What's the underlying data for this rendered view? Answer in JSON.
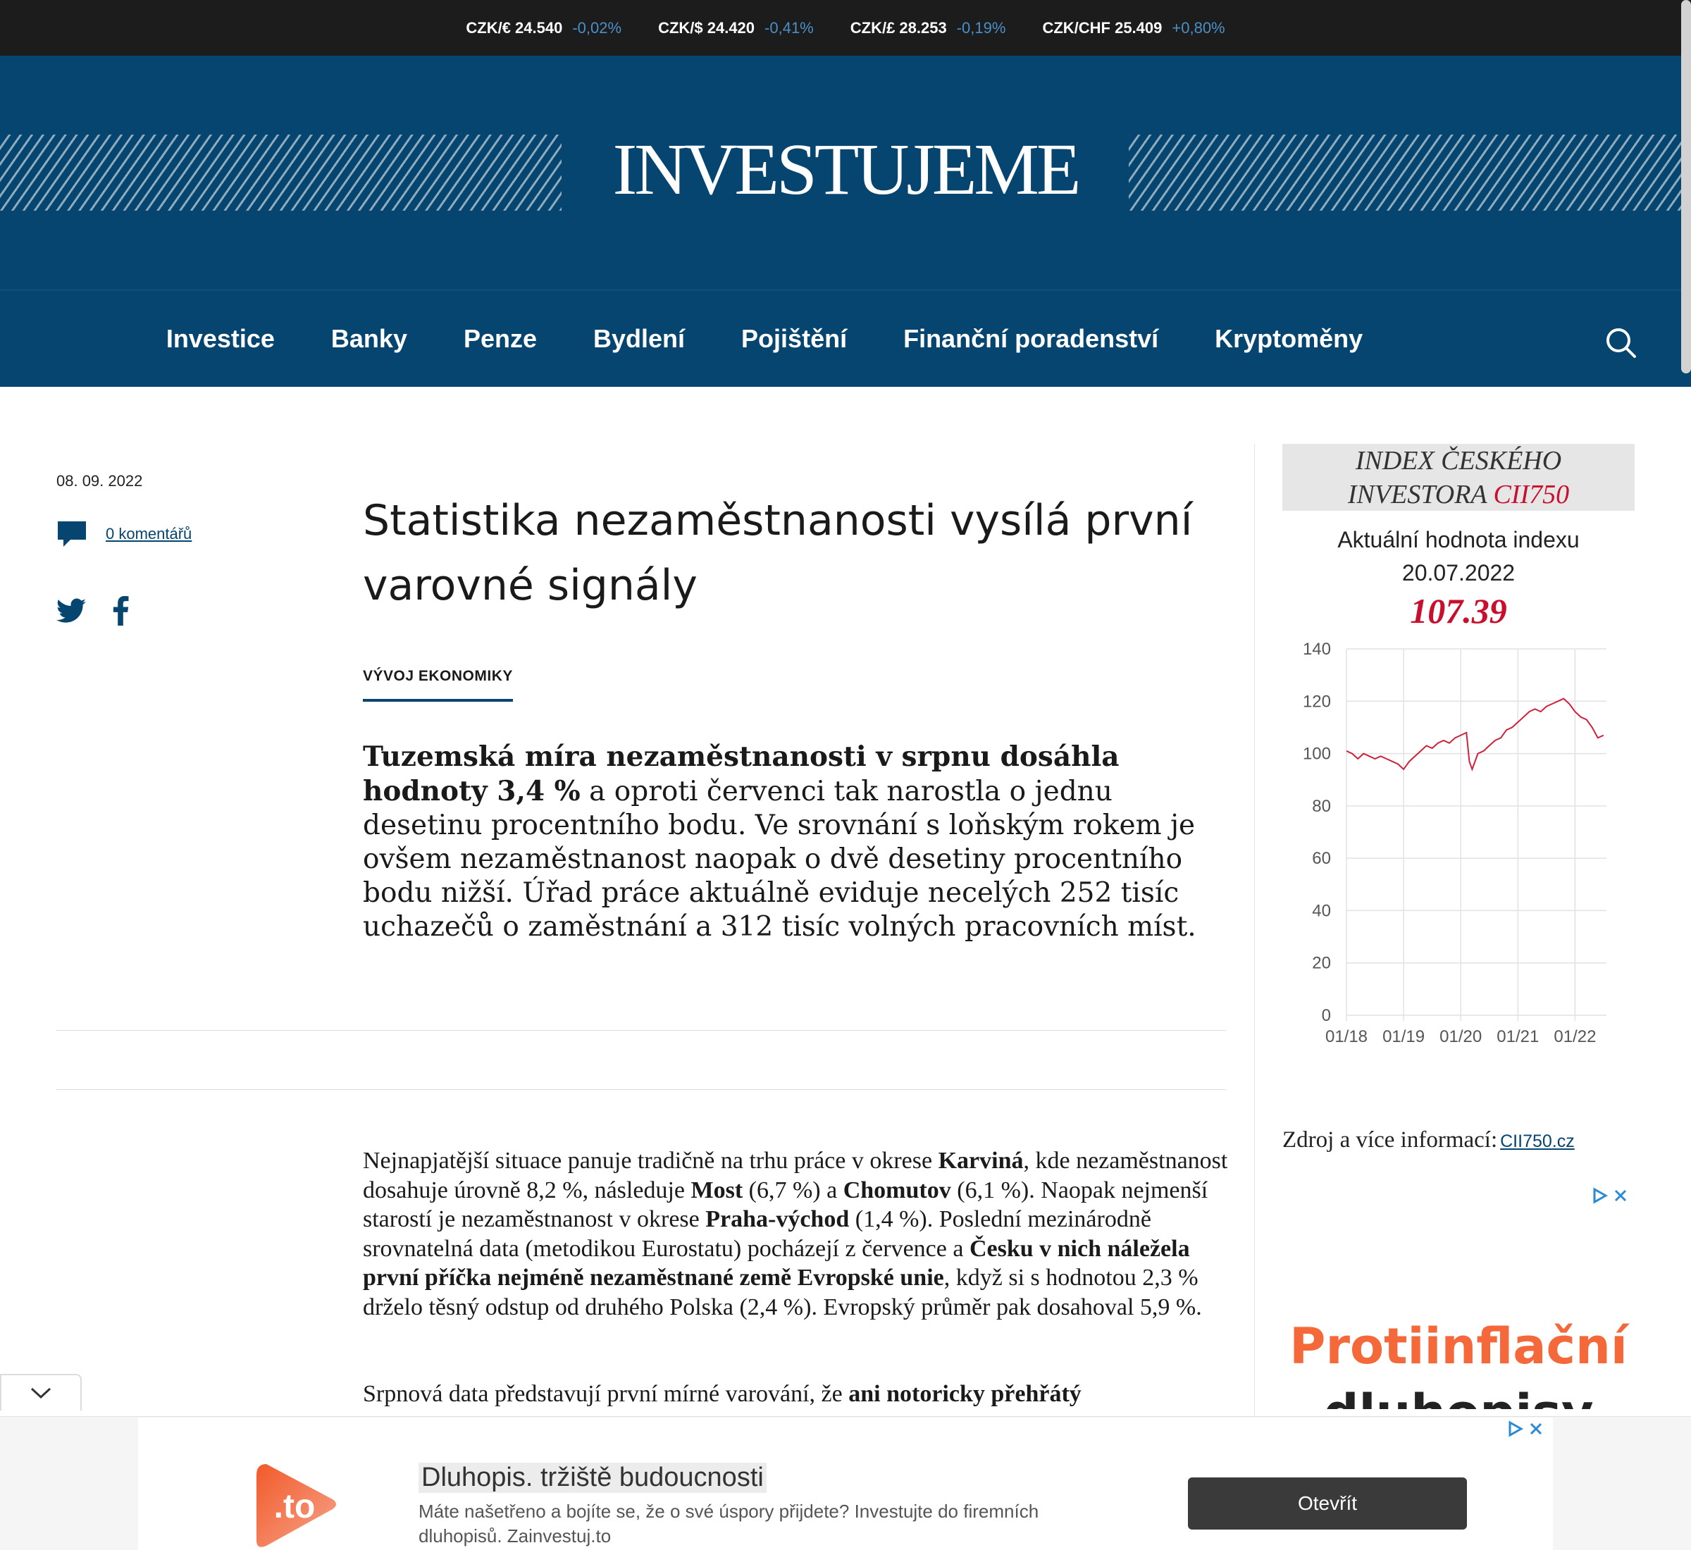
{
  "ticker": [
    {
      "pair": "CZK/€ 24.540",
      "change": "-0,02%"
    },
    {
      "pair": "CZK/$ 24.420",
      "change": "-0,41%"
    },
    {
      "pair": "CZK/£ 28.253",
      "change": "-0,19%"
    },
    {
      "pair": "CZK/CHF 25.409",
      "change": "+0,80%"
    }
  ],
  "site": {
    "logo": "INVESTUJEME"
  },
  "nav": {
    "items": [
      "Investice",
      "Banky",
      "Penze",
      "Bydlení",
      "Pojištění",
      "Finanční poradenství",
      "Kryptoměny"
    ],
    "search_icon": "search-icon"
  },
  "article": {
    "date": "08. 09. 2022",
    "comments": "0 komentářů",
    "title": "Statistika nezaměstnanosti vysílá první varovné signály",
    "category": "VÝVOJ EKONOMIKY",
    "lead_bold": "Tuzemská míra nezaměstnanosti v srpnu dosáhla hodnoty 3,4 %",
    "lead_rest": " a oproti červenci tak narostla o jednu desetinu procentního bodu. Ve srovnání s loňským rokem je ovšem nezaměstnanost naopak o dvě desetiny procentního bodu nižší. Úřad práce aktuálně eviduje necelých 252 tisíc uchazečů o zaměstnání a 312 tisíc volných pracovních míst.",
    "p1": [
      {
        "t": "Nejnapjatější situace panuje tradičně na trhu práce v okrese ",
        "b": false
      },
      {
        "t": "Karviná",
        "b": true
      },
      {
        "t": ", kde nezaměstnanost dosahuje úrovně 8,2 %, následuje ",
        "b": false
      },
      {
        "t": "Most",
        "b": true
      },
      {
        "t": " (6,7 %) a ",
        "b": false
      },
      {
        "t": "Chomutov",
        "b": true
      },
      {
        "t": " (6,1 %). Naopak nejmenší starostí je nezaměstnanost v okrese ",
        "b": false
      },
      {
        "t": "Praha-východ",
        "b": true
      },
      {
        "t": " (1,4 %). Poslední mezinárodně srovnatelná data (metodikou Eurostatu) pocházejí z července a ",
        "b": false
      },
      {
        "t": "Česku v nich náležela první příčka nejméně nezaměstnané země Evropské unie",
        "b": true
      },
      {
        "t": ", když si s hodnotou 2,3 % drželo těsný odstup od druhého Polska (2,4 %). Evropský průměr pak dosahoval 5,9 %.",
        "b": false
      }
    ],
    "p2_plain": "Srpnová data představují první mírné varování, že ",
    "p2_bold": "ani notoricky přehřátý"
  },
  "sidebar": {
    "index_title_1": "INDEX ČESKÉHO",
    "index_title_2": "INVESTORA ",
    "index_title_code": "CII750",
    "current_label": "Aktuální hodnota indexu",
    "current_date": "20.07.2022",
    "current_value": "107.39",
    "source_label": "Zdroj a více informací:",
    "source_link": "CII750.cz",
    "ad_text_1": "Protiinflační",
    "ad_text_2": "dluhopisy"
  },
  "chart_data": {
    "type": "line",
    "x_ticks": [
      "01/18",
      "01/19",
      "01/20",
      "01/21",
      "01/22"
    ],
    "y_ticks": [
      0,
      20,
      40,
      60,
      80,
      100,
      120,
      140
    ],
    "ylim": [
      0,
      140
    ],
    "xlim": [
      2018.0,
      2022.55
    ],
    "color": "#d0213c",
    "series": [
      {
        "x": [
          2018.0,
          2018.1,
          2018.2,
          2018.3,
          2018.4,
          2018.5,
          2018.6,
          2018.7,
          2018.8,
          2018.9,
          2019.0,
          2019.1,
          2019.2,
          2019.3,
          2019.4,
          2019.5,
          2019.6,
          2019.7,
          2019.8,
          2019.9,
          2020.0,
          2020.1,
          2020.15,
          2020.2,
          2020.3,
          2020.4,
          2020.5,
          2020.6,
          2020.7,
          2020.8,
          2020.9,
          2021.0,
          2021.1,
          2021.2,
          2021.3,
          2021.4,
          2021.5,
          2021.6,
          2021.7,
          2021.8,
          2021.9,
          2022.0,
          2022.1,
          2022.2,
          2022.3,
          2022.4,
          2022.5
        ],
        "y": [
          101,
          100,
          98,
          100,
          99,
          98,
          99,
          98,
          97,
          96,
          94,
          97,
          99,
          101,
          103,
          102,
          104,
          105,
          104,
          106,
          107,
          108,
          97,
          94,
          100,
          101,
          103,
          105,
          106,
          109,
          110,
          112,
          114,
          116,
          117,
          116,
          118,
          119,
          120,
          121,
          119,
          116,
          114,
          113,
          110,
          106,
          107
        ]
      }
    ]
  },
  "bottom_ad": {
    "logo_text": ".to",
    "title": "Dluhopis. tržiště budoucnosti",
    "description": "Máte našetřeno a bojíte se, že o své úspory přijdete? Investujte do firemních dluhopisů. Zainvestuj.to",
    "button": "Otevřít"
  }
}
